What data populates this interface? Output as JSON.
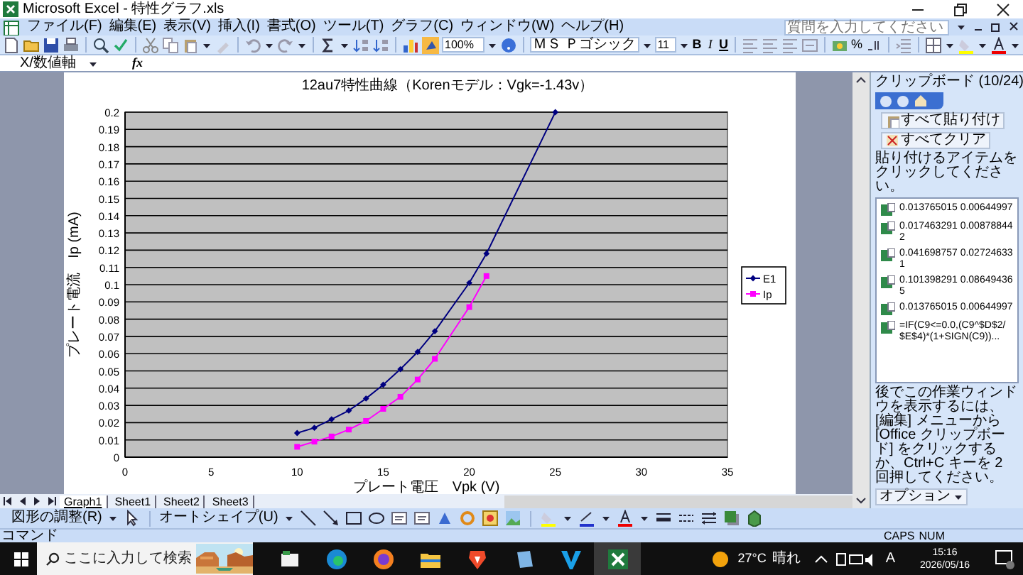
{
  "window": {
    "title": "Microsoft Excel - 特性グラフ.xls"
  },
  "menu": [
    "ファイル(F)",
    "編集(E)",
    "表示(V)",
    "挿入(I)",
    "書式(O)",
    "ツール(T)",
    "グラフ(C)",
    "ウィンドウ(W)",
    "ヘルプ(H)"
  ],
  "help_search": {
    "placeholder": "質問を入力してください"
  },
  "toolbar": {
    "zoom": "100%",
    "font": "ＭＳ Ｐゴシック",
    "font_size": "11",
    "format_buttons": [
      "B",
      "I",
      "U"
    ],
    "percent": "%"
  },
  "formula_bar": {
    "name_box": "X/数値軸",
    "function_label": "fx"
  },
  "chart": {
    "chart_data": {
      "type": "line",
      "title": "12au7特性曲線（Korenモデル：Vgk=-1.43v）",
      "xlabel": "プレート電圧　Vpk (V)",
      "ylabel": "プレート電流　Ip (mA)",
      "x": [
        10,
        11,
        12,
        13,
        14,
        15,
        16,
        17,
        18,
        20,
        21,
        25
      ],
      "series": [
        {
          "name": "E1",
          "color": "#000080",
          "marker": "diamond",
          "values": [
            0.014,
            0.017,
            0.022,
            0.027,
            0.034,
            0.042,
            0.051,
            0.061,
            0.073,
            0.101,
            0.118,
            0.2
          ]
        },
        {
          "name": "Ip",
          "color": "#ff00ff",
          "marker": "square",
          "values": [
            0.006,
            0.009,
            0.012,
            0.016,
            0.021,
            0.028,
            0.035,
            0.045,
            0.057,
            0.087,
            0.105,
            null
          ]
        }
      ],
      "grid": {
        "y": true
      },
      "legend": true,
      "xlim": [
        0,
        35
      ],
      "ylim": [
        0,
        0.2
      ],
      "xticks": [
        0,
        5,
        10,
        15,
        20,
        25,
        30,
        35
      ],
      "yticks": [
        0,
        0.01,
        0.02,
        0.03,
        0.04,
        0.05,
        0.06,
        0.07,
        0.08,
        0.09,
        0.1,
        0.11,
        0.12,
        0.13,
        0.14,
        0.15,
        0.16,
        0.17,
        0.18,
        0.19,
        0.2
      ]
    }
  },
  "sheet_tabs": [
    {
      "label": "Graph1",
      "selected": true
    },
    {
      "label": "Sheet1",
      "selected": false
    },
    {
      "label": "Sheet2",
      "selected": false
    },
    {
      "label": "Sheet3",
      "selected": false
    }
  ],
  "clipboard": {
    "title": "クリップボード (10/24)",
    "paste_all": "すべて貼り付け",
    "clear_all": "すべてクリア",
    "instruction": "貼り付けるアイテムをクリックしてください。",
    "items": [
      "0.013765015 0.00644997",
      "0.017463291 0.008788442",
      "0.041698757 0.027246331",
      "0.101398291 0.086494365",
      "0.013765015 0.00644997",
      "=IF(C9<=0.0,(C9^$D$2/$E$4)*(1+SIGN(C9))..."
    ],
    "note": "後でこの作業ウィンドウを表示するには、[編集] メニューから [Office クリップボード] をクリックするか、Ctrl+C キーを 2 回押してください。",
    "options": "オプション"
  },
  "drawing_toolbar": {
    "arrange": "図形の調整(R)",
    "autoshapes": "オートシェイプ(U)"
  },
  "status_bar": {
    "mode": "コマンド",
    "indicators": [
      "CAPS",
      "NUM"
    ]
  },
  "taskbar": {
    "search_placeholder": "ここに入力して検索",
    "temperature": "27°C",
    "weather": "晴れ",
    "ime": "A",
    "time": "15:16",
    "date": "2026/05/16"
  }
}
